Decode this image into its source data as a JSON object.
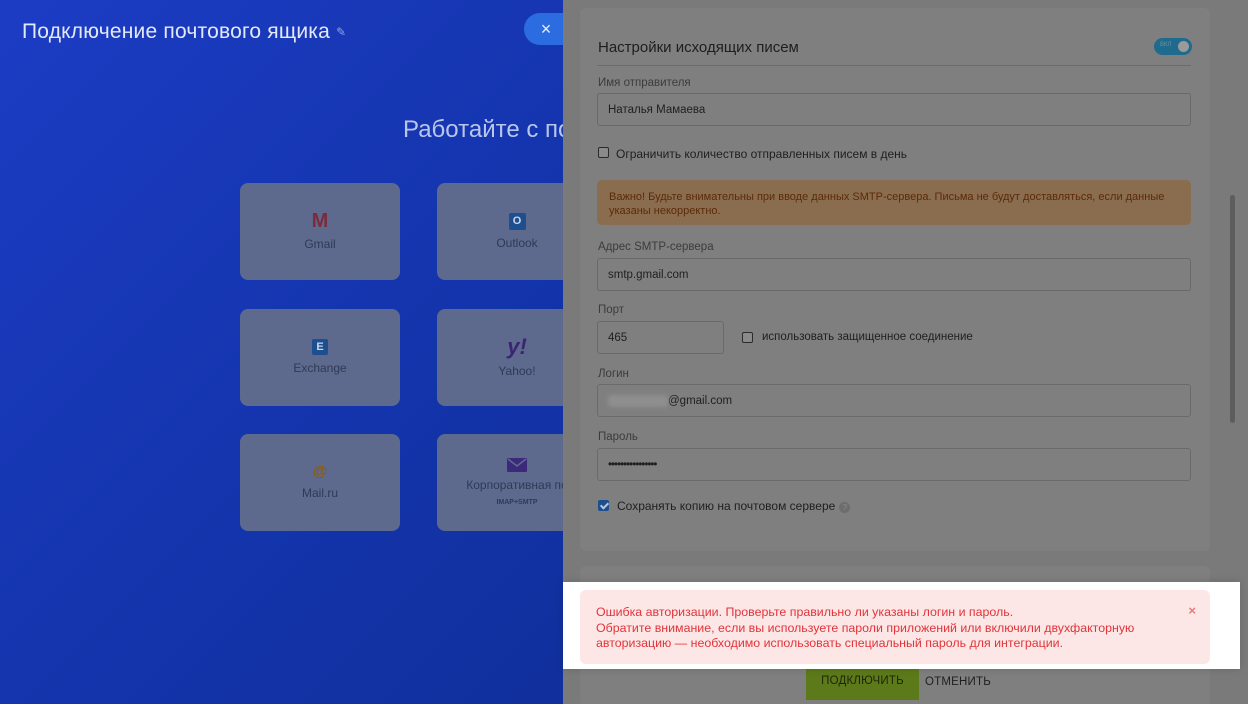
{
  "page": {
    "title": "Подключение почтового ящика",
    "heading": "Работайте с по"
  },
  "providers": [
    {
      "label": "Gmail",
      "icon": "gmail-icon"
    },
    {
      "label": "Outlook",
      "icon": "outlook-icon"
    },
    {
      "label": "Exchange",
      "icon": "exchange-icon"
    },
    {
      "label": "Yahoo!",
      "icon": "yahoo-icon"
    },
    {
      "label": "Mail.ru",
      "icon": "mailru-icon"
    },
    {
      "label": "Корпоративная по",
      "sublabel": "IMAP+SMTP",
      "icon": "envelope-icon"
    }
  ],
  "icons": {
    "gmail_glyph": "M",
    "outlook_glyph": "O",
    "exchange_glyph": "E",
    "yahoo_glyph": "y!",
    "mailru_glyph": "@",
    "close_glyph": "×",
    "help_glyph": "?",
    "pin_glyph": "✎"
  },
  "panel": {
    "section_title": "Настройки исходящих писем",
    "toggle_text": "ВКЛ",
    "toggle_on": true,
    "sender_label": "Имя отправителя",
    "sender_value": "Наталья Мамаева",
    "limit_label": "Ограничить количество отправленных писем в день",
    "limit_checked": false,
    "warning": "Важно! Будьте внимательны при вводе данных SMTP-сервера. Письма не будут доставляться, если данные указаны некорректно.",
    "smtp_label": "Адрес SMTP-сервера",
    "smtp_value": "smtp.gmail.com",
    "port_label": "Порт",
    "port_value": "465",
    "secure_label": "использовать защищенное соединение",
    "secure_checked": false,
    "login_label": "Логин",
    "login_value_suffix": "@gmail.com",
    "password_label": "Пароль",
    "password_value": "••••••••••••••••",
    "save_copy_label": "Сохранять копию на почтовом сервере",
    "save_copy_checked": true
  },
  "error": {
    "line1": "Ошибка авторизации. Проверьте правильно ли указаны логин и пароль.",
    "line2": "Обратите внимание, если вы используете пароли приложений или включили двухфакторную",
    "line3": "авторизацию — необходимо использовать специальный пароль для интеграции."
  },
  "actions": {
    "connect": "ПОДКЛЮЧИТЬ",
    "cancel": "ОТМЕНИТЬ"
  },
  "colors": {
    "accent": "#2b6ce0",
    "error_text": "#e0353a",
    "error_bg": "#fde6e6",
    "connect_button": "#8bc34a"
  }
}
